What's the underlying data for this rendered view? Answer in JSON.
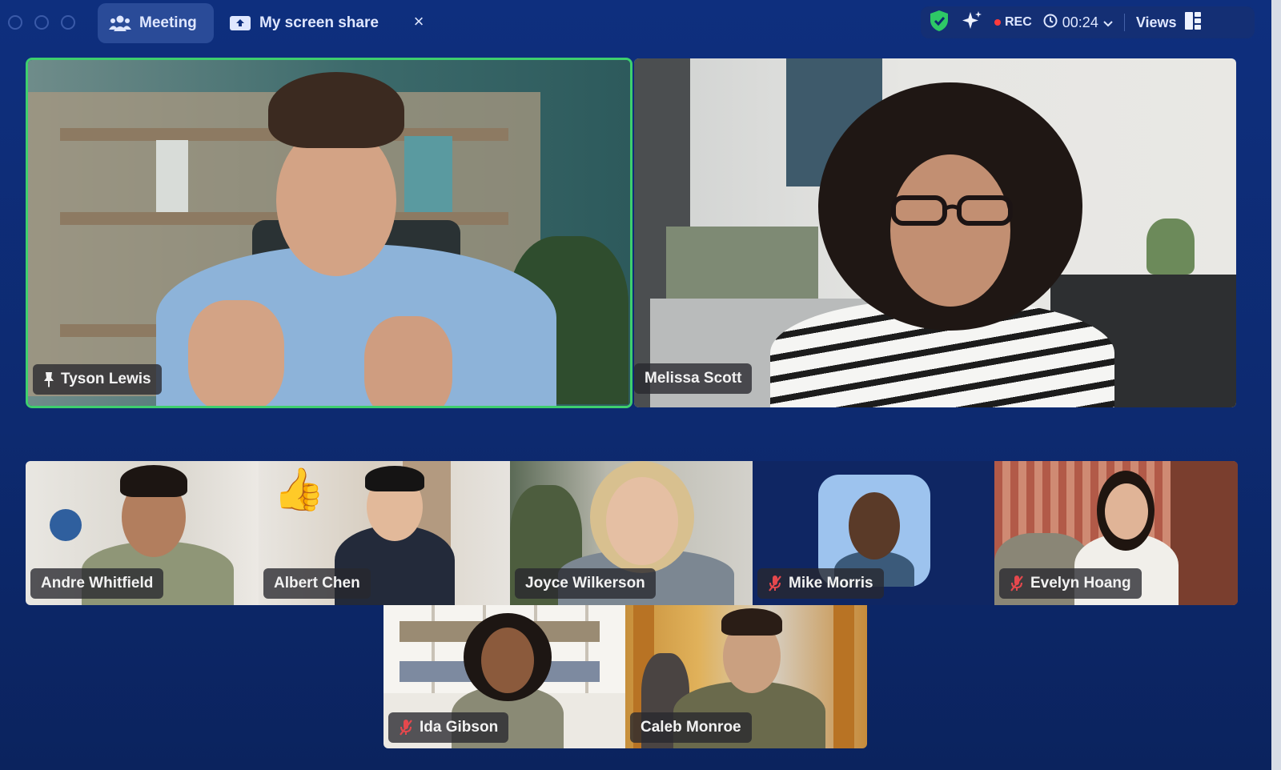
{
  "window": {
    "tabs": [
      {
        "label": "Meeting",
        "icon": "people-icon",
        "active": true
      },
      {
        "label": "My screen share",
        "icon": "share-screen-icon",
        "active": false
      }
    ]
  },
  "status": {
    "rec_label": "REC",
    "timer": "00:24",
    "views_label": "Views"
  },
  "speakers": [
    {
      "name": "Tyson Lewis",
      "pinned": true,
      "active_speaker": true
    },
    {
      "name": "Melissa Scott",
      "pinned": false
    }
  ],
  "gallery": [
    {
      "name": "Andre Whitfield",
      "muted": false
    },
    {
      "name": "Albert Chen",
      "muted": false,
      "reaction": "👍"
    },
    {
      "name": "Joyce Wilkerson",
      "muted": false
    },
    {
      "name": "Mike Morris",
      "muted": true,
      "avatar_only": true
    },
    {
      "name": "Evelyn Hoang",
      "muted": true
    },
    {
      "name": "Ida Gibson",
      "muted": true
    },
    {
      "name": "Caleb Monroe",
      "muted": false
    }
  ],
  "colors": {
    "background": "#0d2a70",
    "active_speaker_border": "#3ecf6e",
    "muted_icon": "#e5484d",
    "shield": "#2ec866"
  }
}
